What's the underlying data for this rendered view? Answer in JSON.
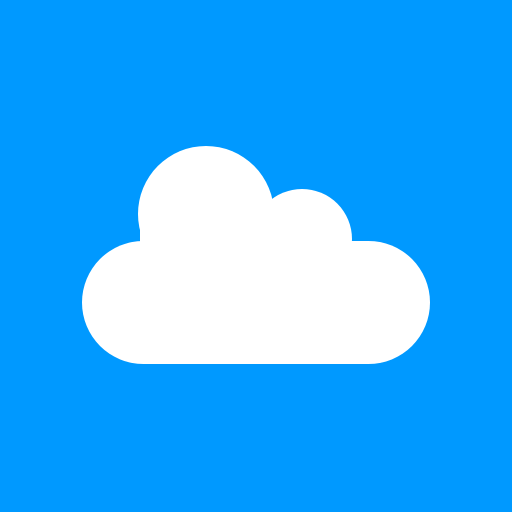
{
  "icon": {
    "name": "cloud-icon",
    "background_color": "#0099FF",
    "cloud_color": "#FFFFFF"
  }
}
